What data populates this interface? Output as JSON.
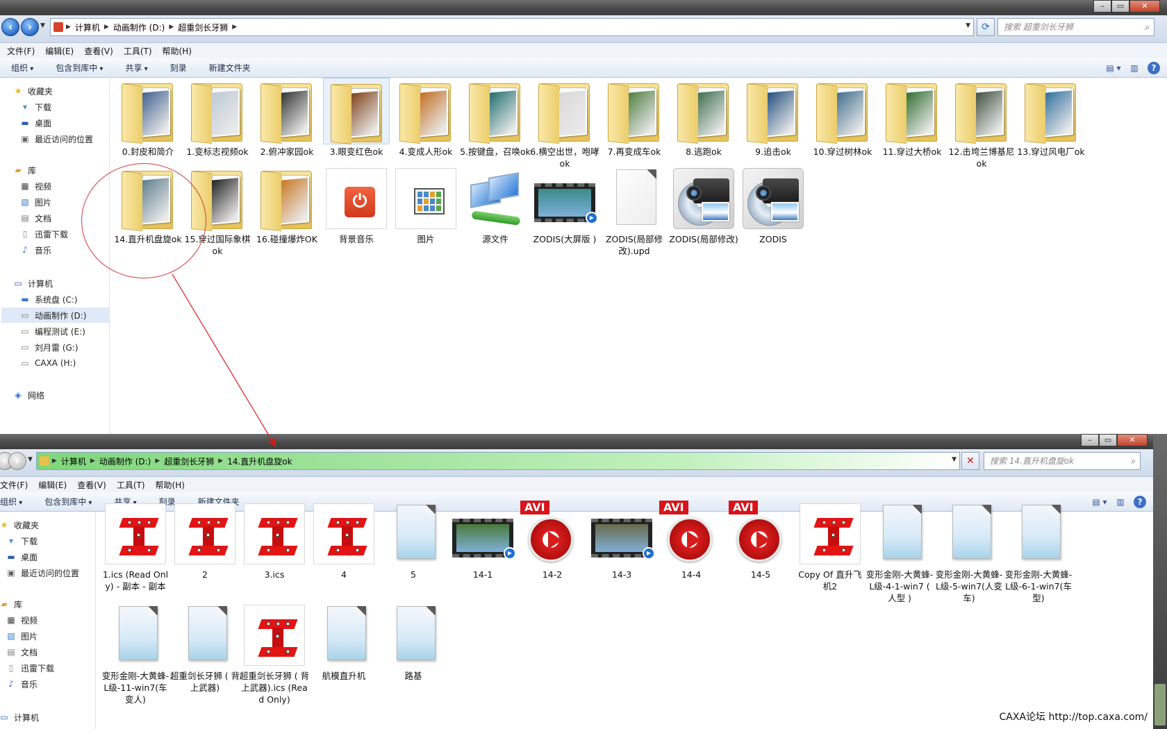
{
  "window1": {
    "address": {
      "crumbs": [
        "计算机",
        "动画制作 (D:)",
        "超重剑长牙狮"
      ]
    },
    "search_placeholder": "搜索 超重剑长牙狮",
    "menu": [
      "文件(F)",
      "编辑(E)",
      "查看(V)",
      "工具(T)",
      "帮助(H)"
    ],
    "commands": [
      "组织",
      "包含到库中",
      "共享",
      "刻录",
      "新建文件夹"
    ],
    "nav": {
      "favorites": "收藏夹",
      "fav_items": [
        "下载",
        "桌面",
        "最近访问的位置"
      ],
      "libraries": "库",
      "lib_items": [
        "视频",
        "图片",
        "文档",
        "迅雷下载",
        "音乐"
      ],
      "computer": "计算机",
      "drives": [
        "系统盘 (C:)",
        "动画制作 (D:)",
        "编程测试 (E:)",
        "刘月雷 (G:)",
        "CAXA (H:)"
      ],
      "network": "网络"
    },
    "items": [
      {
        "label": "0.封皮和简介",
        "kind": "folder",
        "color": "#3a5a8a"
      },
      {
        "label": "1.变标志视频ok",
        "kind": "folder",
        "color": "#bcc8d4"
      },
      {
        "label": "2.俯冲家园ok",
        "kind": "folder",
        "color": "#2b2b2b"
      },
      {
        "label": "3.眼变红色ok",
        "kind": "folder",
        "color": "#7a3a10"
      },
      {
        "label": "4.变成人形ok",
        "kind": "folder",
        "color": "#c06a1a"
      },
      {
        "label": "5.按键盘，召唤ok",
        "kind": "folder",
        "color": "#1a6a6a"
      },
      {
        "label": "6.横空出世，咆哮ok",
        "kind": "folder",
        "color": "#d8d8d8"
      },
      {
        "label": "7.再变成车ok",
        "kind": "folder",
        "color": "#4a7a3a"
      },
      {
        "label": "8.逃跑ok",
        "kind": "folder",
        "color": "#3a6a4a"
      },
      {
        "label": "9.追击ok",
        "kind": "folder",
        "color": "#1a4a7a"
      },
      {
        "label": "10.穿过树林ok",
        "kind": "folder",
        "color": "#3a6a8a"
      },
      {
        "label": "11.穿过大桥ok",
        "kind": "folder",
        "color": "#2a6a2a"
      },
      {
        "label": "12.击垮兰博基尼ok",
        "kind": "folder",
        "color": "#3a4a3a"
      },
      {
        "label": "13.穿过风电厂ok",
        "kind": "folder",
        "color": "#2a6a9a"
      },
      {
        "label": "14.直升机盘旋ok",
        "kind": "folder",
        "color": "#5a7a8a"
      },
      {
        "label": "15.穿过国际象棋ok",
        "kind": "folder",
        "color": "#1a1a1a"
      },
      {
        "label": "16.碰撞爆炸OK",
        "kind": "folder",
        "color": "#c8741a"
      },
      {
        "label": "背景音乐",
        "kind": "power"
      },
      {
        "label": "图片",
        "kind": "gallery"
      },
      {
        "label": "源文件",
        "kind": "computers"
      },
      {
        "label": "ZODIS(大屏版 )",
        "kind": "film",
        "color": "#3a8a8a"
      },
      {
        "label": "ZODIS(局部修改).upd",
        "kind": "blank"
      },
      {
        "label": "ZODIS(局部修改)",
        "kind": "camera"
      },
      {
        "label": "ZODIS",
        "kind": "camera"
      }
    ]
  },
  "window2": {
    "address": {
      "crumbs": [
        "计算机",
        "动画制作 (D:)",
        "超重剑长牙狮",
        "14.直升机盘旋ok"
      ]
    },
    "search_placeholder": "搜索 14.直升机盘旋ok",
    "menu": [
      "文件(F)",
      "编辑(E)",
      "查看(V)",
      "工具(T)",
      "帮助(H)"
    ],
    "commands": [
      "组织",
      "包含到库中",
      "共享",
      "刻录",
      "新建文件夹"
    ],
    "nav": {
      "favorites": "收藏夹",
      "fav_items": [
        "下载",
        "桌面",
        "最近访问的位置"
      ],
      "libraries": "库",
      "lib_items": [
        "视频",
        "图片",
        "文档",
        "迅雷下载",
        "音乐"
      ],
      "computer": "计算机"
    },
    "items": [
      {
        "label": "1.ics (Read Only) - 副本 - 副本",
        "kind": "ics"
      },
      {
        "label": "2",
        "kind": "ics"
      },
      {
        "label": "3.ics",
        "kind": "ics"
      },
      {
        "label": "4",
        "kind": "ics"
      },
      {
        "label": "5",
        "kind": "note"
      },
      {
        "label": "14-1",
        "kind": "film",
        "color": "#4a7a3a"
      },
      {
        "label": "14-2",
        "kind": "avi",
        "tag": "AVI"
      },
      {
        "label": "14-3",
        "kind": "film",
        "color": "#6a6a4a"
      },
      {
        "label": "14-4",
        "kind": "avi",
        "tag": "AVI"
      },
      {
        "label": "14-5",
        "kind": "avi",
        "tag": "AVI"
      },
      {
        "label": "Copy Of 直升飞机2",
        "kind": "ics"
      },
      {
        "label": "变形金刚-大黄蜂-L级-4-1-win7 ( 人型 )",
        "kind": "note"
      },
      {
        "label": "变形金刚-大黄蜂-L级-5-win7(人变车)",
        "kind": "note"
      },
      {
        "label": "变形金刚-大黄蜂-L级-6-1-win7(车型)",
        "kind": "note"
      },
      {
        "label": "变形金刚-大黄蜂-L级-11-win7(车变人)",
        "kind": "note"
      },
      {
        "label": "超重剑长牙狮 ( 背上武器)",
        "kind": "note"
      },
      {
        "label": "超重剑长牙狮 ( 背上武器).ics (Read Only)",
        "kind": "ics"
      },
      {
        "label": "航模直升机",
        "kind": "note"
      },
      {
        "label": "路基",
        "kind": "note"
      }
    ]
  },
  "watermark": "CAXA论坛  http://top.caxa.com/"
}
